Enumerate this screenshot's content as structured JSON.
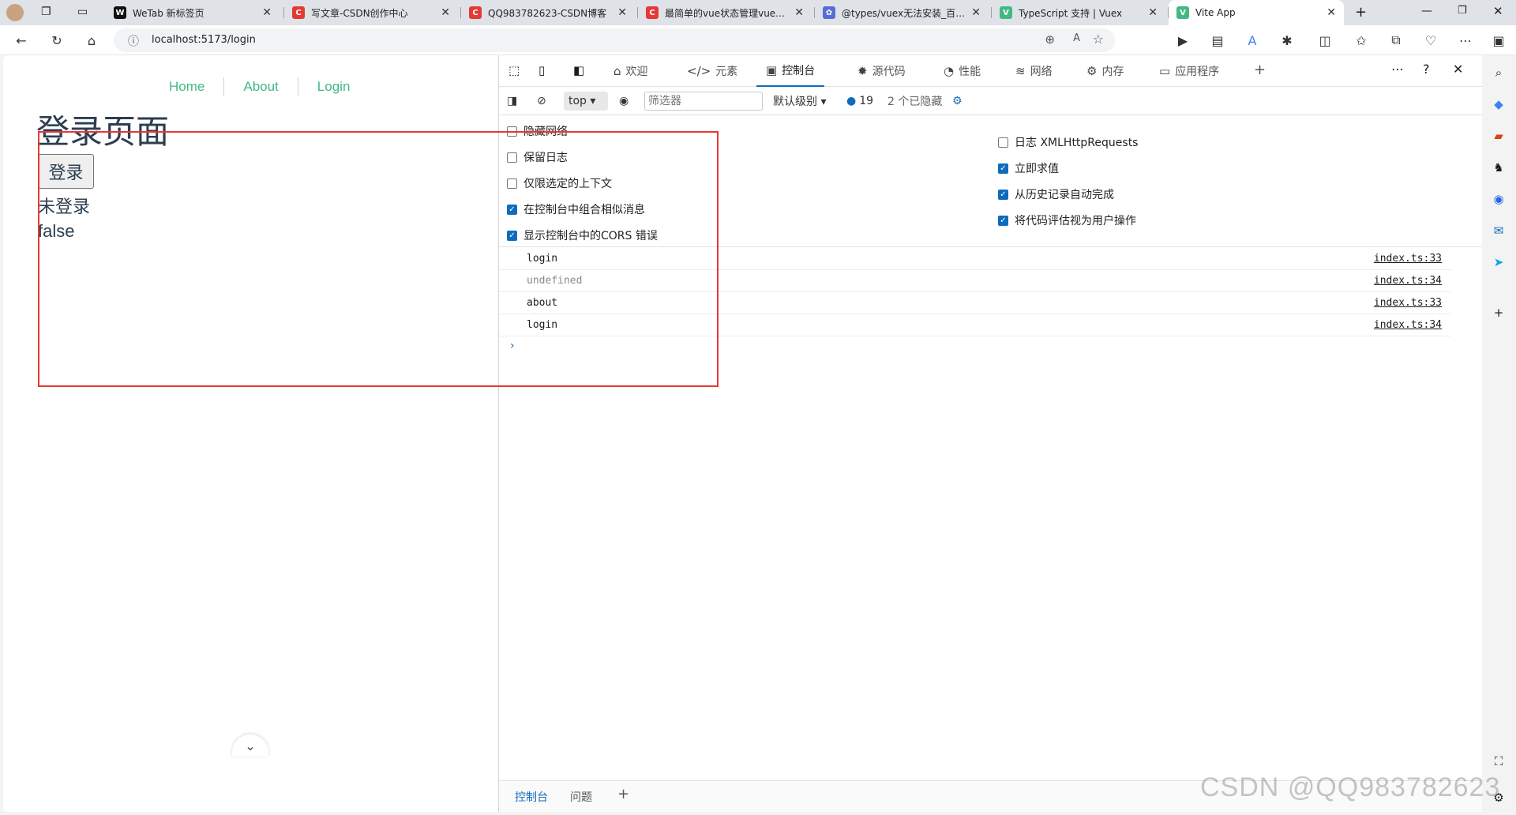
{
  "tabs": [
    {
      "title": "WeTab 新标签页",
      "favicon": "W",
      "color": "#111"
    },
    {
      "title": "写文章-CSDN创作中心",
      "favicon": "C",
      "color": "#e53935"
    },
    {
      "title": "QQ983782623-CSDN博客",
      "favicon": "C",
      "color": "#e53935"
    },
    {
      "title": "最简单的vue状态管理vuex示例",
      "favicon": "C",
      "color": "#e53935"
    },
    {
      "title": "@types/vuex无法安装_百度搜索",
      "favicon": "✿",
      "color": "#5b6bd6"
    },
    {
      "title": "TypeScript 支持 | Vuex",
      "favicon": "V",
      "color": "#42b883"
    },
    {
      "title": "Vite App",
      "favicon": "V",
      "color": "#42b883"
    }
  ],
  "address": {
    "url": "localhost:5173/login"
  },
  "app": {
    "nav": [
      "Home",
      "About",
      "Login"
    ],
    "title": "登录页面",
    "login_button": "登录",
    "status_text": "未登录",
    "status_bool": "false"
  },
  "devtools": {
    "tabs": [
      "欢迎",
      "元素",
      "控制台",
      "源代码",
      "性能",
      "网络",
      "内存",
      "应用程序"
    ],
    "console_bar": {
      "context": "top",
      "filter_placeholder": "筛选器",
      "level": "默认级别 ▾",
      "message_count": "19",
      "hidden": "2 个已隐藏"
    },
    "options_left": [
      {
        "label": "隐藏网络",
        "checked": false
      },
      {
        "label": "保留日志",
        "checked": false
      },
      {
        "label": "仅限选定的上下文",
        "checked": false
      },
      {
        "label": "在控制台中组合相似消息",
        "checked": true
      },
      {
        "label": "显示控制台中的CORS 错误",
        "checked": true
      }
    ],
    "options_right": [
      {
        "label": "日志 XMLHttpRequests",
        "checked": false
      },
      {
        "label": "立即求值",
        "checked": true
      },
      {
        "label": "从历史记录自动完成",
        "checked": true
      },
      {
        "label": "将代码评估视为用户操作",
        "checked": true
      }
    ],
    "logs": [
      {
        "msg": "login",
        "src": "index.ts:33",
        "dim": false
      },
      {
        "msg": "undefined",
        "src": "index.ts:34",
        "dim": true
      },
      {
        "msg": "about",
        "src": "index.ts:33",
        "dim": false
      },
      {
        "msg": "login",
        "src": "index.ts:34",
        "dim": false
      }
    ],
    "prompt": "›",
    "drawer": [
      "控制台",
      "问题"
    ]
  },
  "watermark": "CSDN @QQ983782623"
}
